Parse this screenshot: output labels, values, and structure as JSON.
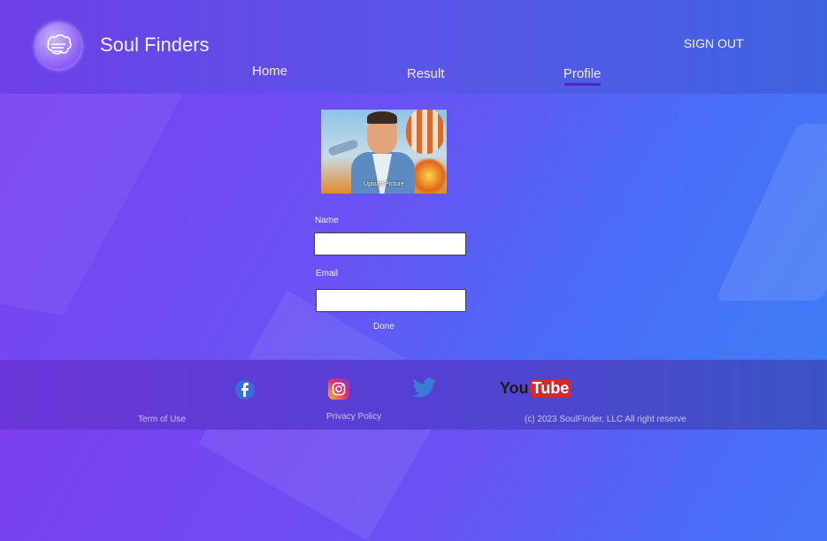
{
  "header": {
    "brand": "Soul Finders",
    "sign_out": "SIGN OUT",
    "nav": {
      "home": "Home",
      "result": "Result",
      "profile": "Profile"
    }
  },
  "profile": {
    "upload_label": "Upload Picture",
    "name_label": "Name",
    "name_value": "",
    "email_label": "Email",
    "email_value": "",
    "done_label": "Done"
  },
  "footer": {
    "terms": "Term of Use",
    "privacy": "Privacy Policy",
    "copyright": "(c) 2023 SoulFinder, LLC All right reserve",
    "social": [
      "facebook-icon",
      "instagram-icon",
      "twitter-icon",
      "youtube-icon"
    ],
    "youtube_you": "You",
    "youtube_tube": "Tube"
  },
  "colors": {
    "accent_underline": "#4b2bbd",
    "background_start": "#7b3ff0",
    "background_end": "#3f7ef6"
  }
}
